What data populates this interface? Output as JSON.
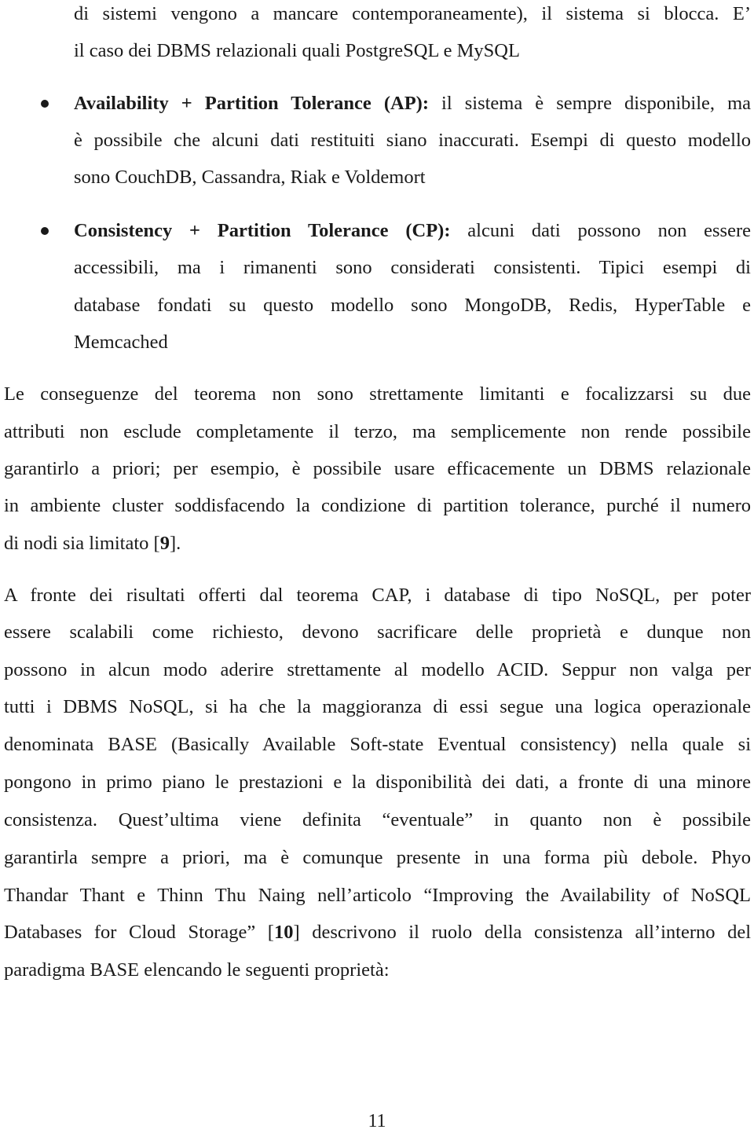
{
  "document": {
    "continuation": {
      "lines": [
        "di sistemi vengono a mancare contemporaneamente), il sistema si blocca.  E’",
        "il caso dei DBMS relazionali quali PostgreSQL e MySQL"
      ]
    },
    "bullets": [
      {
        "term": "Availability + Partition Tolerance (AP):",
        "first_line_rest": " il sistema è sempre disponibile, ma",
        "lines": [
          "è possibile che alcuni dati restituiti siano inaccurati. Esempi di questo modello",
          "sono CouchDB, Cassandra, Riak e Voldemort"
        ]
      },
      {
        "term": "Consistency + Partition Tolerance (CP):",
        "first_line_rest": " alcuni dati possono non essere",
        "lines": [
          "accessibili, ma i rimanenti sono considerati consistenti. Tipici esempi di",
          "database fondati su questo modello sono MongoDB, Redis, HyperTable e",
          "Memcached"
        ]
      }
    ],
    "paragraph1": {
      "lines": [
        "Le conseguenze del teorema non sono strettamente limitanti e focalizzarsi su due",
        "attributi non esclude completamente il terzo, ma semplicemente non rende possibile",
        "garantirlo a priori; per esempio, è possibile usare efficacemente un DBMS relazionale",
        "in ambiente cluster soddisfacendo la condizione di partition tolerance, purché il numero"
      ],
      "last_line_prefix": "di nodi sia limitato [",
      "citation": "9",
      "last_line_suffix": "]."
    },
    "paragraph2": {
      "lines": [
        "A fronte dei risultati offerti dal teorema CAP, i database di tipo NoSQL, per poter",
        "essere scalabili come richiesto, devono sacrificare delle proprietà e dunque non",
        "possono in alcun modo aderire strettamente al modello ACID. Seppur non valga per",
        "tutti i DBMS NoSQL, si ha che la maggioranza di essi segue una logica operazionale",
        "denominata BASE (Basically Available Soft-state Eventual consistency) nella quale si",
        "pongono in primo piano le prestazioni e la disponibilità dei dati, a fronte di una minore",
        "consistenza. Quest’ultima viene definita “eventuale” in quanto non è possibile",
        "garantirla sempre a priori, ma è comunque presente in una forma più debole. Phyo",
        "Thandar Thant e Thinn Thu Naing nell’articolo “Improving the Availability of NoSQL"
      ],
      "citation_line_prefix": "Databases for Cloud Storage” [",
      "citation": "10",
      "citation_line_suffix": "] descrivono il ruolo della consistenza all’interno del",
      "last_line": "paradigma BASE elencando le seguenti proprietà:"
    },
    "page_number": "11"
  }
}
